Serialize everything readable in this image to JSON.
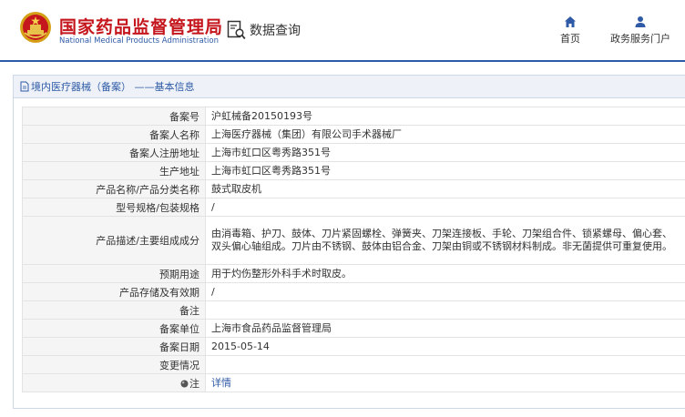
{
  "header": {
    "brand_cn": "国家药品监督管理局",
    "brand_en": "National Medical Products Administration",
    "query_label": "数据查询",
    "nav": [
      {
        "label": "首页",
        "icon": "home-icon"
      },
      {
        "label": "政务服务门户",
        "icon": "user-icon"
      }
    ]
  },
  "panel": {
    "title": "境内医疗器械（备案） ——基本信息"
  },
  "records": [
    {
      "label": "备案号",
      "value": "沪虹械备20150193号"
    },
    {
      "label": "备案人名称",
      "value": "上海医疗器械（集团）有限公司手术器械厂"
    },
    {
      "label": "备案人注册地址",
      "value": "上海市虹口区粤秀路351号"
    },
    {
      "label": "生产地址",
      "value": "上海市虹口区粤秀路351号"
    },
    {
      "label": "产品名称/产品分类名称",
      "value": "鼓式取皮机"
    },
    {
      "label": "型号规格/包装规格",
      "value": "/"
    },
    {
      "label": "产品描述/主要组成成分",
      "value": "由消毒箱、护刀、鼓体、刀片紧固螺栓、弹簧夹、刀架连接板、手轮、刀架组合件、锁紧螺母、偏心套、双头偏心轴组成。刀片由不锈钢、鼓体由铝合金、刀架由铜或不锈钢材料制成。非无菌提供可重复使用。"
    },
    {
      "label": "预期用途",
      "value": "用于灼伤整形外科手术时取皮。"
    },
    {
      "label": "产品存储及有效期",
      "value": "/"
    },
    {
      "label": "备注",
      "value": ""
    },
    {
      "label": "备案单位",
      "value": "上海市食品药品监督管理局"
    },
    {
      "label": "备案日期",
      "value": "2015-05-14"
    },
    {
      "label": "变更情况",
      "value": ""
    },
    {
      "label": "注",
      "value": "详情"
    }
  ],
  "colors": {
    "brand_red": "#c4161c",
    "brand_blue": "#2e5aa6",
    "label_bg": "#f5f5f5",
    "title_bg": "#eef2f8"
  }
}
